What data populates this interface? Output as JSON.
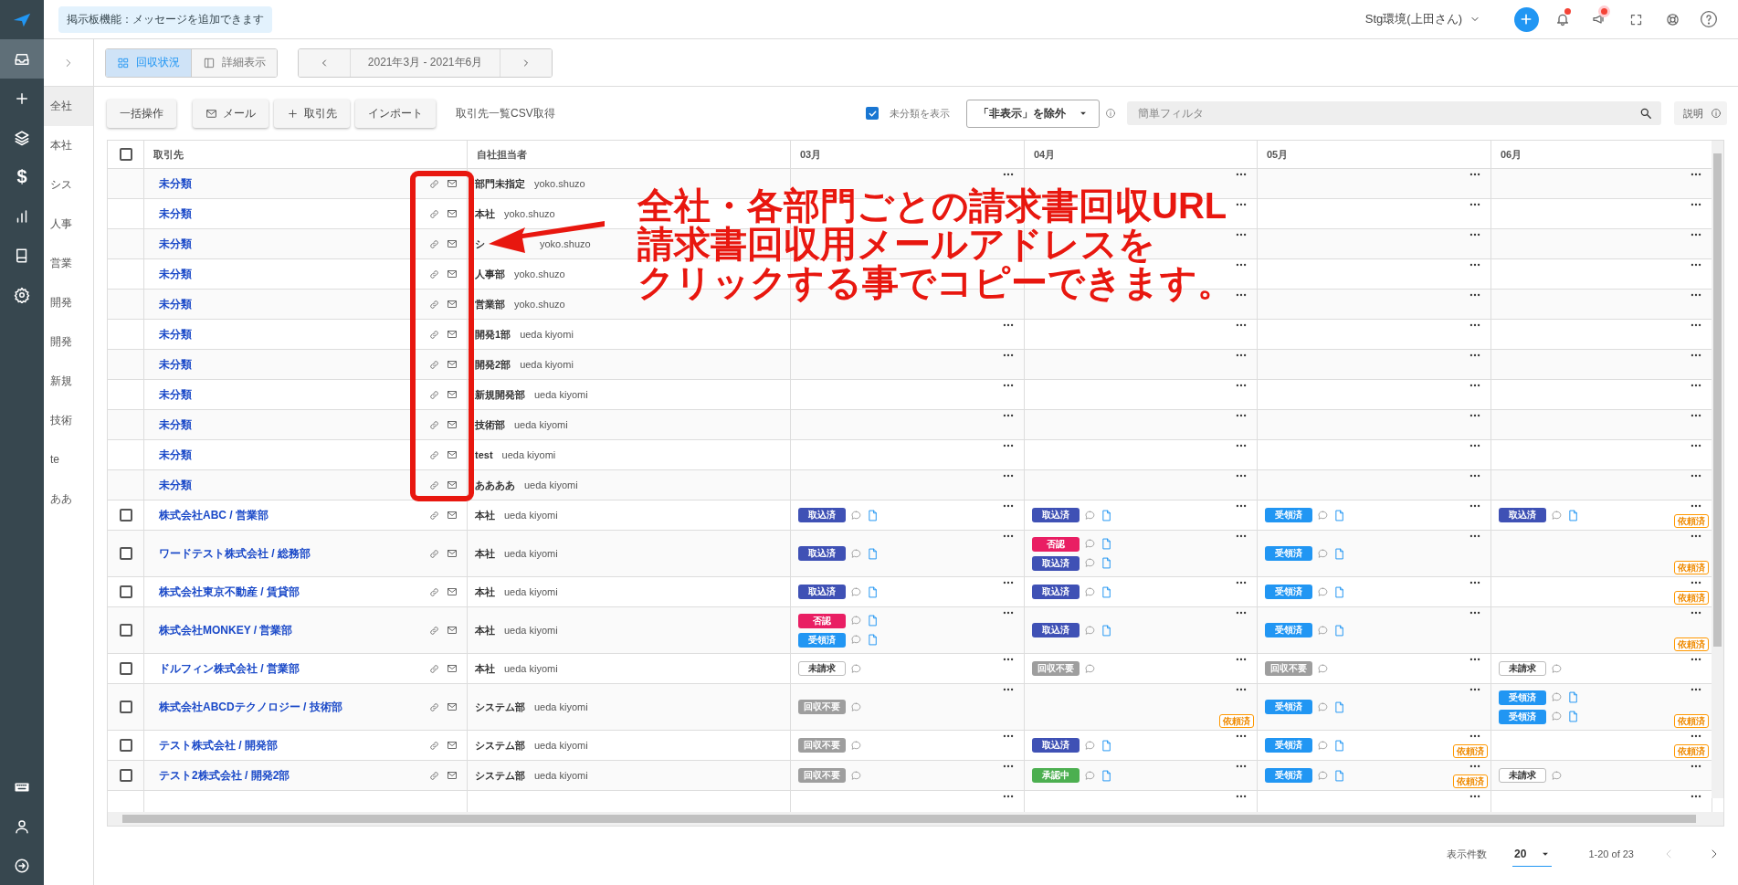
{
  "rail": [
    {
      "kind": "logo",
      "selected": false
    },
    {
      "kind": "inbox",
      "selected": true
    },
    {
      "kind": "plus",
      "selected": false
    },
    {
      "kind": "layers",
      "selected": false
    },
    {
      "kind": "dollar",
      "text": "$",
      "selected": false
    },
    {
      "kind": "chart",
      "selected": false
    },
    {
      "kind": "book",
      "selected": false
    },
    {
      "kind": "gear",
      "selected": false
    }
  ],
  "rail_bottom": [
    {
      "kind": "keyboard"
    },
    {
      "kind": "person"
    },
    {
      "kind": "logout"
    }
  ],
  "topbar": {
    "notice": "掲示板機能：メッセージを追加できます",
    "environment": "Stg環境(上田さん)",
    "bell_alert": true,
    "megaphone_alert": true
  },
  "view_tabs": [
    {
      "label": "回収状況",
      "kind": "grid",
      "selected": true
    },
    {
      "label": "詳細表示",
      "kind": "panel",
      "selected": false
    }
  ],
  "period": "2021年3月 - 2021年6月",
  "subnav": [
    {
      "label": "全社",
      "selected": true
    },
    {
      "label": "本社",
      "selected": false
    },
    {
      "label": "シス",
      "selected": false
    },
    {
      "label": "人事",
      "selected": false
    },
    {
      "label": "営業",
      "selected": false
    },
    {
      "label": "開発",
      "selected": false
    },
    {
      "label": "開発",
      "selected": false
    },
    {
      "label": "新規",
      "selected": false
    },
    {
      "label": "技術",
      "selected": false
    },
    {
      "label": "te",
      "selected": false
    },
    {
      "label": "ああ",
      "selected": false
    }
  ],
  "actions": [
    {
      "label": "一括操作",
      "kind": "plain"
    },
    {
      "label": "メール",
      "kind": "mail"
    },
    {
      "label": "取引先",
      "kind": "add"
    },
    {
      "label": "インポート",
      "kind": "plain"
    }
  ],
  "csv_link": "取引先一覧CSV取得",
  "show_unclassified": {
    "label": "未分類を表示",
    "checked": true
  },
  "visibility_select": "「非表示」を除外",
  "filter": {
    "placeholder": "簡単フィルタ"
  },
  "help_button": "説明",
  "table": {
    "select_all_checked": false,
    "columns": [
      "取引先",
      "自社担当者",
      "03月",
      "04月",
      "05月",
      "06月"
    ],
    "rows": [
      {
        "kind": "unclassified",
        "client": "未分類",
        "dept": "部門未指定",
        "person": "yoko.shuzo"
      },
      {
        "kind": "unclassified",
        "client": "未分類",
        "dept": "本社",
        "person": "yoko.shuzo"
      },
      {
        "kind": "unclassified",
        "client": "未分類",
        "dept": "シ",
        "person": "yoko.shuzo",
        "pointer": true
      },
      {
        "kind": "unclassified",
        "client": "未分類",
        "dept": "人事部",
        "person": "yoko.shuzo"
      },
      {
        "kind": "unclassified",
        "client": "未分類",
        "dept": "営業部",
        "person": "yoko.shuzo"
      },
      {
        "kind": "unclassified",
        "client": "未分類",
        "dept": "開発1部",
        "person": "ueda kiyomi"
      },
      {
        "kind": "unclassified",
        "client": "未分類",
        "dept": "開発2部",
        "person": "ueda kiyomi"
      },
      {
        "kind": "unclassified",
        "client": "未分類",
        "dept": "新規開発部",
        "person": "ueda kiyomi"
      },
      {
        "kind": "unclassified",
        "client": "未分類",
        "dept": "技術部",
        "person": "ueda kiyomi"
      },
      {
        "kind": "unclassified",
        "client": "未分類",
        "dept": "test",
        "person": "ueda kiyomi"
      },
      {
        "kind": "unclassified",
        "client": "未分類",
        "dept": "ああああ",
        "person": "ueda kiyomi"
      },
      {
        "kind": "client",
        "checked": false,
        "client": "株式会社ABC / 営業部",
        "dept": "本社",
        "person": "ueda kiyomi",
        "months": [
          {
            "entries": [
              {
                "kind": "imported",
                "label": "取込済"
              }
            ]
          },
          {
            "entries": [
              {
                "kind": "imported",
                "label": "取込済"
              }
            ]
          },
          {
            "entries": [
              {
                "kind": "received",
                "label": "受領済"
              }
            ]
          },
          {
            "entries": [
              {
                "kind": "imported",
                "label": "取込済"
              }
            ],
            "tag": "依頼済"
          }
        ]
      },
      {
        "kind": "client",
        "checked": false,
        "client": "ワードテスト株式会社 / 総務部",
        "dept": "本社",
        "person": "ueda kiyomi",
        "months": [
          {
            "entries": [
              {
                "kind": "imported",
                "label": "取込済"
              }
            ]
          },
          {
            "entries": [
              {
                "kind": "rejected",
                "label": "否認"
              },
              {
                "kind": "imported",
                "label": "取込済"
              }
            ]
          },
          {
            "entries": [
              {
                "kind": "received",
                "label": "受領済"
              }
            ]
          },
          {
            "tag": "依頼済"
          }
        ]
      },
      {
        "kind": "client",
        "checked": false,
        "client": "株式会社東京不動産 / 賃貸部",
        "dept": "本社",
        "person": "ueda kiyomi",
        "months": [
          {
            "entries": [
              {
                "kind": "imported",
                "label": "取込済"
              }
            ]
          },
          {
            "entries": [
              {
                "kind": "imported",
                "label": "取込済"
              }
            ]
          },
          {
            "entries": [
              {
                "kind": "received",
                "label": "受領済"
              }
            ]
          },
          {
            "tag": "依頼済"
          }
        ]
      },
      {
        "kind": "client",
        "checked": false,
        "client": "株式会社MONKEY / 営業部",
        "dept": "本社",
        "person": "ueda kiyomi",
        "months": [
          {
            "entries": [
              {
                "kind": "rejected",
                "label": "否認"
              },
              {
                "kind": "received",
                "label": "受領済"
              }
            ]
          },
          {
            "entries": [
              {
                "kind": "imported",
                "label": "取込済"
              }
            ]
          },
          {
            "entries": [
              {
                "kind": "received",
                "label": "受領済"
              }
            ]
          },
          {
            "tag": "依頼済"
          }
        ]
      },
      {
        "kind": "client",
        "checked": false,
        "client": "ドルフィン株式会社 / 営業部",
        "dept": "本社",
        "person": "ueda kiyomi",
        "months": [
          {
            "entries": [
              {
                "kind": "unbilled",
                "label": "未請求"
              }
            ]
          },
          {
            "entries": [
              {
                "kind": "unneeded",
                "label": "回収不要"
              }
            ]
          },
          {
            "entries": [
              {
                "kind": "unneeded",
                "label": "回収不要"
              }
            ]
          },
          {
            "entries": [
              {
                "kind": "unbilled",
                "label": "未請求"
              }
            ]
          }
        ]
      },
      {
        "kind": "client",
        "checked": false,
        "client": "株式会社ABCDテクノロジー / 技術部",
        "dept": "システム部",
        "person": "ueda kiyomi",
        "months": [
          {
            "entries": [
              {
                "kind": "unneeded",
                "label": "回収不要"
              }
            ]
          },
          {
            "tag": "依頼済"
          },
          {
            "entries": [
              {
                "kind": "received",
                "label": "受領済"
              }
            ]
          },
          {
            "entries": [
              {
                "kind": "received",
                "label": "受領済"
              },
              {
                "kind": "received",
                "label": "受領済"
              }
            ],
            "tag": "依頼済"
          }
        ]
      },
      {
        "kind": "client",
        "checked": false,
        "client": "テスト株式会社 / 開発部",
        "dept": "システム部",
        "person": "ueda kiyomi",
        "months": [
          {
            "entries": [
              {
                "kind": "unneeded",
                "label": "回収不要"
              }
            ]
          },
          {
            "entries": [
              {
                "kind": "imported",
                "label": "取込済"
              }
            ]
          },
          {
            "entries": [
              {
                "kind": "received",
                "label": "受領済"
              }
            ],
            "tag": "依頼済"
          },
          {
            "tag": "依頼済"
          }
        ]
      },
      {
        "kind": "client",
        "checked": false,
        "client": "テスト2株式会社 / 開発2部",
        "dept": "システム部",
        "person": "ueda kiyomi",
        "months": [
          {
            "entries": [
              {
                "kind": "unneeded",
                "label": "回収不要"
              }
            ]
          },
          {
            "entries": [
              {
                "kind": "pending",
                "label": "承認中"
              }
            ]
          },
          {
            "entries": [
              {
                "kind": "received",
                "label": "受領済"
              }
            ],
            "tag": "依頼済"
          },
          {
            "entries": [
              {
                "kind": "unbilled",
                "label": "未請求"
              }
            ]
          }
        ]
      },
      {
        "kind": "partial"
      }
    ]
  },
  "pager": {
    "label": "表示件数",
    "page_size": "20",
    "range": "1-20 of 23",
    "prev_disabled": true,
    "next_disabled": false
  },
  "annotation": {
    "lines": [
      "全社・各部門ごとの請求書回収URL",
      "請求書回収用メールアドレスを",
      "クリックする事でコピーできます。"
    ]
  }
}
